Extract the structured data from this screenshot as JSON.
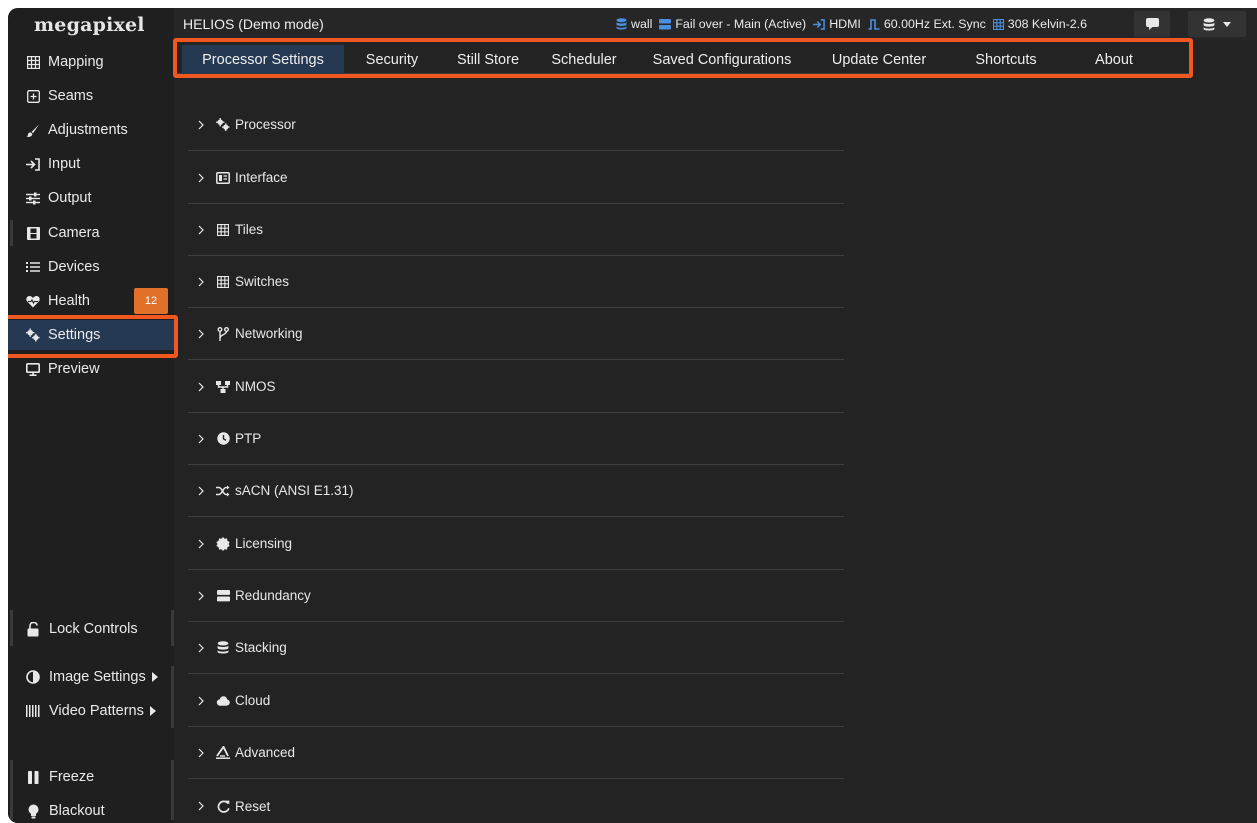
{
  "brand": {
    "logo": "megapixel"
  },
  "header": {
    "title": "HELIOS (Demo mode)",
    "status": [
      {
        "icon": "database-icon",
        "text": "wall"
      },
      {
        "icon": "server-icon",
        "text": "Fail over - Main (Active)"
      },
      {
        "icon": "input-icon",
        "text": "HDMI"
      },
      {
        "icon": "sync-icon",
        "text": "60.00Hz Ext. Sync"
      },
      {
        "icon": "grid-icon",
        "text": "308 Kelvin-2.6"
      }
    ]
  },
  "sidebar": {
    "items": [
      {
        "label": "Mapping",
        "icon": "grid-icon"
      },
      {
        "label": "Seams",
        "icon": "plus-square-icon"
      },
      {
        "label": "Adjustments",
        "icon": "brush-icon"
      },
      {
        "label": "Input",
        "icon": "input-icon"
      },
      {
        "label": "Output",
        "icon": "sliders-icon"
      },
      {
        "label": "Camera",
        "icon": "film-icon"
      },
      {
        "label": "Devices",
        "icon": "list-icon"
      },
      {
        "label": "Health",
        "icon": "heartbeat-icon",
        "badge": "12"
      },
      {
        "label": "Settings",
        "icon": "gears-icon",
        "active": true
      },
      {
        "label": "Preview",
        "icon": "monitor-icon"
      }
    ],
    "bottom": [
      {
        "label": "Lock Controls",
        "icon": "unlock-icon"
      },
      {
        "label": "Image Settings",
        "icon": "contrast-icon"
      },
      {
        "label": "Video Patterns",
        "icon": "barcode-icon"
      },
      {
        "label": "Freeze",
        "icon": "pause-icon"
      },
      {
        "label": "Blackout",
        "icon": "lightbulb-icon"
      }
    ]
  },
  "tabs": [
    {
      "label": "Processor Settings",
      "active": true
    },
    {
      "label": "Security"
    },
    {
      "label": "Still Store"
    },
    {
      "label": "Scheduler"
    },
    {
      "label": "Saved Configurations"
    },
    {
      "label": "Update Center"
    },
    {
      "label": "Shortcuts"
    },
    {
      "label": "About"
    }
  ],
  "sections": [
    {
      "label": "Processor",
      "icon": "gears-icon"
    },
    {
      "label": "Interface",
      "icon": "interface-icon"
    },
    {
      "label": "Tiles",
      "icon": "grid-icon"
    },
    {
      "label": "Switches",
      "icon": "grid-icon"
    },
    {
      "label": "Networking",
      "icon": "branch-icon"
    },
    {
      "label": "NMOS",
      "icon": "network-icon"
    },
    {
      "label": "PTP",
      "icon": "clock-icon"
    },
    {
      "label": "sACN (ANSI E1.31)",
      "icon": "shuffle-icon"
    },
    {
      "label": "Licensing",
      "icon": "certificate-icon"
    },
    {
      "label": "Redundancy",
      "icon": "server-icon"
    },
    {
      "label": "Stacking",
      "icon": "database-icon"
    },
    {
      "label": "Cloud",
      "icon": "cloud-icon"
    },
    {
      "label": "Advanced",
      "icon": "advanced-icon"
    },
    {
      "label": "Reset",
      "icon": "reset-icon"
    }
  ],
  "colors": {
    "background": "#232323",
    "sidebar": "#1f1f1f",
    "active": "#253952",
    "badge": "#e0702a",
    "highlight": "#f0581f",
    "status_icon": "#4a8fe0"
  }
}
